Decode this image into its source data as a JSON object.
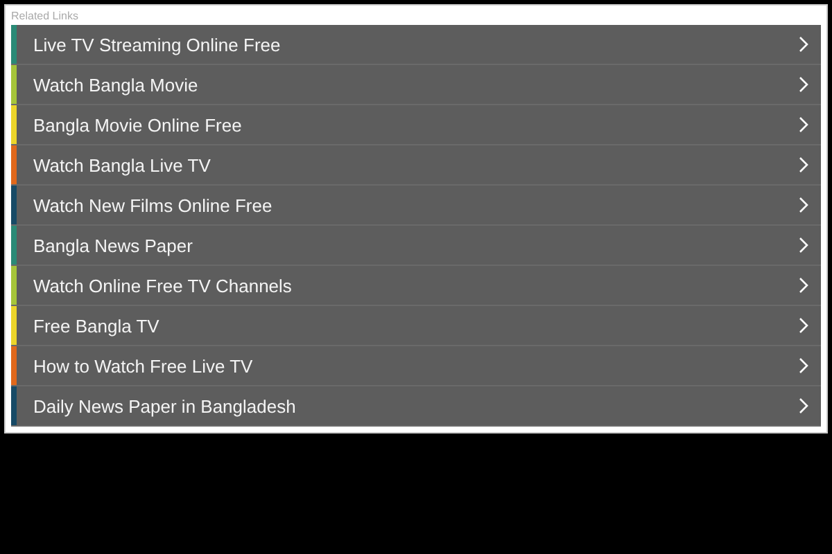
{
  "heading": "Related Links",
  "links": [
    {
      "label": "Live TV Streaming Online Free",
      "color": "#2a8a76"
    },
    {
      "label": "Watch Bangla Movie",
      "color": "#a6c53a"
    },
    {
      "label": "Bangla Movie Online Free",
      "color": "#ecd52a"
    },
    {
      "label": "Watch Bangla Live TV",
      "color": "#e0681c"
    },
    {
      "label": "Watch New Films Online Free",
      "color": "#174a66"
    },
    {
      "label": "Bangla News Paper",
      "color": "#2a8a76"
    },
    {
      "label": "Watch Online Free TV Channels",
      "color": "#a6c53a"
    },
    {
      "label": "Free Bangla TV",
      "color": "#ecd52a"
    },
    {
      "label": "How to Watch Free Live TV",
      "color": "#e0681c"
    },
    {
      "label": "Daily News Paper in Bangladesh",
      "color": "#174a66"
    }
  ]
}
